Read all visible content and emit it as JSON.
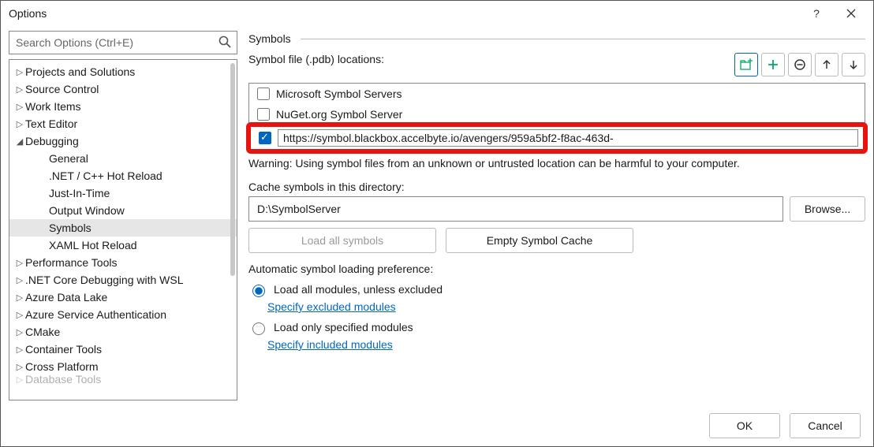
{
  "window": {
    "title": "Options"
  },
  "search": {
    "placeholder": "Search Options (Ctrl+E)"
  },
  "tree": [
    {
      "label": "Projects and Solutions",
      "kind": "closed"
    },
    {
      "label": "Source Control",
      "kind": "closed"
    },
    {
      "label": "Work Items",
      "kind": "closed"
    },
    {
      "label": "Text Editor",
      "kind": "closed"
    },
    {
      "label": "Debugging",
      "kind": "open"
    },
    {
      "label": "General",
      "kind": "child"
    },
    {
      "label": ".NET / C++ Hot Reload",
      "kind": "child"
    },
    {
      "label": "Just-In-Time",
      "kind": "child"
    },
    {
      "label": "Output Window",
      "kind": "child"
    },
    {
      "label": "Symbols",
      "kind": "child",
      "selected": true
    },
    {
      "label": "XAML Hot Reload",
      "kind": "child"
    },
    {
      "label": "Performance Tools",
      "kind": "closed"
    },
    {
      "label": ".NET Core Debugging with WSL",
      "kind": "closed"
    },
    {
      "label": "Azure Data Lake",
      "kind": "closed"
    },
    {
      "label": "Azure Service Authentication",
      "kind": "closed"
    },
    {
      "label": "CMake",
      "kind": "closed"
    },
    {
      "label": "Container Tools",
      "kind": "closed"
    },
    {
      "label": "Cross Platform",
      "kind": "closed"
    },
    {
      "label": "Database Tools",
      "kind": "closed-cut"
    }
  ],
  "section": {
    "title": "Symbols"
  },
  "symbols": {
    "locations_label": "Symbol file (.pdb) locations:",
    "items": [
      {
        "checked": false,
        "label": "Microsoft Symbol Servers"
      },
      {
        "checked": false,
        "label": "NuGet.org Symbol Server"
      }
    ],
    "custom": {
      "checked": true,
      "url": "https://symbol.blackbox.accelbyte.io/avengers/959a5bf2-f8ac-463d-"
    },
    "warning": "Warning: Using symbol files from an unknown or untrusted location can be harmful to your computer."
  },
  "cache": {
    "label": "Cache symbols in this directory:",
    "path": "D:\\SymbolServer",
    "browse": "Browse..."
  },
  "actions": {
    "load_all": "Load all symbols",
    "empty": "Empty Symbol Cache"
  },
  "pref": {
    "label": "Automatic symbol loading preference:",
    "opt1": "Load all modules, unless excluded",
    "link1": "Specify excluded modules",
    "opt2": "Load only specified modules",
    "link2": "Specify included modules"
  },
  "footer": {
    "ok": "OK",
    "cancel": "Cancel"
  }
}
